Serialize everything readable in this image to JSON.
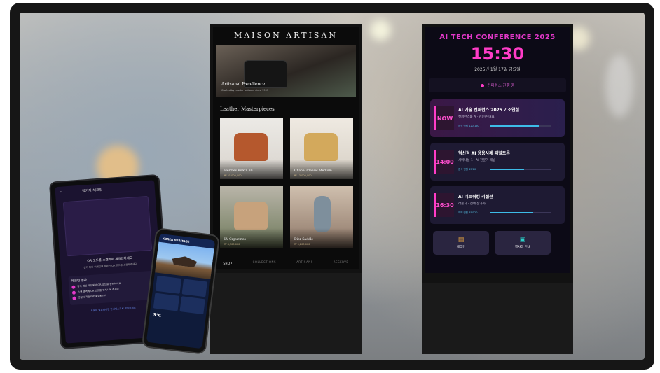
{
  "kiosk_fashion": {
    "brand": "MAISON ARTISAN",
    "hero_title": "Artisanal Excellence",
    "hero_subtitle": "Crafted by master artisans since 1997",
    "section_title": "Leather Masterpieces",
    "products": [
      {
        "name": "Hermès Birkin 30",
        "price": "₩ 21,000,000",
        "color": "#b5582d"
      },
      {
        "name": "Chanel Classic Medium",
        "price": "₩ 13,000,000",
        "color": "#d3a95c"
      },
      {
        "name": "LV Capucines",
        "price": "₩ 8,500,000",
        "color": "#c7a27c"
      },
      {
        "name": "Dior Saddle",
        "price": "₩ 5,200,000",
        "color": "#7e8f9c"
      }
    ],
    "nav": [
      "SHOP",
      "COLLECTIONS",
      "ARTISANS",
      "RESERVE"
    ],
    "nav_active_index": 0
  },
  "kiosk_conference": {
    "title": "AI TECH CONFERENCE 2025",
    "time": "15:30",
    "date": "2025년 1월 17일 금요일",
    "live_label": "컨퍼런스 진행 중",
    "sessions": [
      {
        "time": "NOW",
        "title": "AI 기술 컨퍼런스 2025 기조연설",
        "subtitle": "컨퍼런스홀 A · 김민준 대표",
        "meta": "참석 인원 120/150",
        "progress": 0.8
      },
      {
        "time": "14:00",
        "title": "혁신적 AI 응용사례 패널토론",
        "subtitle": "세미나실 1 · AI 전문가 패널",
        "meta": "참석 인원 45/80",
        "progress": 0.56
      },
      {
        "time": "16:30",
        "title": "AI 네트워킹 리셉션",
        "subtitle": "라운지 · 전체 참가자",
        "meta": "예약 인원 85/120",
        "progress": 0.71
      }
    ],
    "actions": [
      {
        "label": "체크인",
        "icon": "document-icon"
      },
      {
        "label": "행사장 안내",
        "icon": "book-icon"
      }
    ],
    "colors": {
      "accent": "#ff3cc7",
      "progress": "#3dbce8"
    }
  },
  "tablet": {
    "header": "참가자 체크인",
    "qr_title": "QR 코드를 스캔하여 체크인하세요",
    "qr_desc": "참가 확인 이메일에 포함된 QR 코드를 스캔해주세요",
    "steps_title": "체크인 절차",
    "steps": [
      "참가 확인 메일에서 QR 코드를 준비하세요",
      "스캔 영역에 QR 코드를 위치시켜 주세요",
      "명찰이 자동으로 출력됩니다"
    ],
    "footer": "도움이 필요하시면 안내데스크로 문의하세요"
  },
  "phone": {
    "header": "KOREA HERITAGE",
    "temperature": "3°C"
  }
}
